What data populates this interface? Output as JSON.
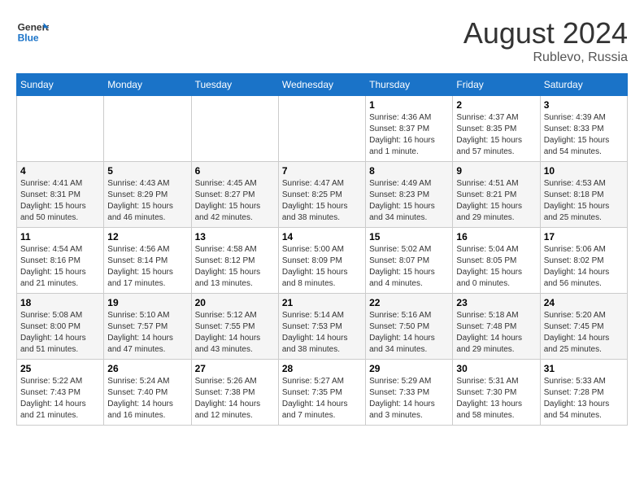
{
  "header": {
    "logo_line1": "General",
    "logo_line2": "Blue",
    "month_year": "August 2024",
    "location": "Rublevo, Russia"
  },
  "days_of_week": [
    "Sunday",
    "Monday",
    "Tuesday",
    "Wednesday",
    "Thursday",
    "Friday",
    "Saturday"
  ],
  "weeks": [
    [
      {
        "day": "",
        "info": ""
      },
      {
        "day": "",
        "info": ""
      },
      {
        "day": "",
        "info": ""
      },
      {
        "day": "",
        "info": ""
      },
      {
        "day": "1",
        "info": "Sunrise: 4:36 AM\nSunset: 8:37 PM\nDaylight: 16 hours\nand 1 minute."
      },
      {
        "day": "2",
        "info": "Sunrise: 4:37 AM\nSunset: 8:35 PM\nDaylight: 15 hours\nand 57 minutes."
      },
      {
        "day": "3",
        "info": "Sunrise: 4:39 AM\nSunset: 8:33 PM\nDaylight: 15 hours\nand 54 minutes."
      }
    ],
    [
      {
        "day": "4",
        "info": "Sunrise: 4:41 AM\nSunset: 8:31 PM\nDaylight: 15 hours\nand 50 minutes."
      },
      {
        "day": "5",
        "info": "Sunrise: 4:43 AM\nSunset: 8:29 PM\nDaylight: 15 hours\nand 46 minutes."
      },
      {
        "day": "6",
        "info": "Sunrise: 4:45 AM\nSunset: 8:27 PM\nDaylight: 15 hours\nand 42 minutes."
      },
      {
        "day": "7",
        "info": "Sunrise: 4:47 AM\nSunset: 8:25 PM\nDaylight: 15 hours\nand 38 minutes."
      },
      {
        "day": "8",
        "info": "Sunrise: 4:49 AM\nSunset: 8:23 PM\nDaylight: 15 hours\nand 34 minutes."
      },
      {
        "day": "9",
        "info": "Sunrise: 4:51 AM\nSunset: 8:21 PM\nDaylight: 15 hours\nand 29 minutes."
      },
      {
        "day": "10",
        "info": "Sunrise: 4:53 AM\nSunset: 8:18 PM\nDaylight: 15 hours\nand 25 minutes."
      }
    ],
    [
      {
        "day": "11",
        "info": "Sunrise: 4:54 AM\nSunset: 8:16 PM\nDaylight: 15 hours\nand 21 minutes."
      },
      {
        "day": "12",
        "info": "Sunrise: 4:56 AM\nSunset: 8:14 PM\nDaylight: 15 hours\nand 17 minutes."
      },
      {
        "day": "13",
        "info": "Sunrise: 4:58 AM\nSunset: 8:12 PM\nDaylight: 15 hours\nand 13 minutes."
      },
      {
        "day": "14",
        "info": "Sunrise: 5:00 AM\nSunset: 8:09 PM\nDaylight: 15 hours\nand 8 minutes."
      },
      {
        "day": "15",
        "info": "Sunrise: 5:02 AM\nSunset: 8:07 PM\nDaylight: 15 hours\nand 4 minutes."
      },
      {
        "day": "16",
        "info": "Sunrise: 5:04 AM\nSunset: 8:05 PM\nDaylight: 15 hours\nand 0 minutes."
      },
      {
        "day": "17",
        "info": "Sunrise: 5:06 AM\nSunset: 8:02 PM\nDaylight: 14 hours\nand 56 minutes."
      }
    ],
    [
      {
        "day": "18",
        "info": "Sunrise: 5:08 AM\nSunset: 8:00 PM\nDaylight: 14 hours\nand 51 minutes."
      },
      {
        "day": "19",
        "info": "Sunrise: 5:10 AM\nSunset: 7:57 PM\nDaylight: 14 hours\nand 47 minutes."
      },
      {
        "day": "20",
        "info": "Sunrise: 5:12 AM\nSunset: 7:55 PM\nDaylight: 14 hours\nand 43 minutes."
      },
      {
        "day": "21",
        "info": "Sunrise: 5:14 AM\nSunset: 7:53 PM\nDaylight: 14 hours\nand 38 minutes."
      },
      {
        "day": "22",
        "info": "Sunrise: 5:16 AM\nSunset: 7:50 PM\nDaylight: 14 hours\nand 34 minutes."
      },
      {
        "day": "23",
        "info": "Sunrise: 5:18 AM\nSunset: 7:48 PM\nDaylight: 14 hours\nand 29 minutes."
      },
      {
        "day": "24",
        "info": "Sunrise: 5:20 AM\nSunset: 7:45 PM\nDaylight: 14 hours\nand 25 minutes."
      }
    ],
    [
      {
        "day": "25",
        "info": "Sunrise: 5:22 AM\nSunset: 7:43 PM\nDaylight: 14 hours\nand 21 minutes."
      },
      {
        "day": "26",
        "info": "Sunrise: 5:24 AM\nSunset: 7:40 PM\nDaylight: 14 hours\nand 16 minutes."
      },
      {
        "day": "27",
        "info": "Sunrise: 5:26 AM\nSunset: 7:38 PM\nDaylight: 14 hours\nand 12 minutes."
      },
      {
        "day": "28",
        "info": "Sunrise: 5:27 AM\nSunset: 7:35 PM\nDaylight: 14 hours\nand 7 minutes."
      },
      {
        "day": "29",
        "info": "Sunrise: 5:29 AM\nSunset: 7:33 PM\nDaylight: 14 hours\nand 3 minutes."
      },
      {
        "day": "30",
        "info": "Sunrise: 5:31 AM\nSunset: 7:30 PM\nDaylight: 13 hours\nand 58 minutes."
      },
      {
        "day": "31",
        "info": "Sunrise: 5:33 AM\nSunset: 7:28 PM\nDaylight: 13 hours\nand 54 minutes."
      }
    ]
  ]
}
